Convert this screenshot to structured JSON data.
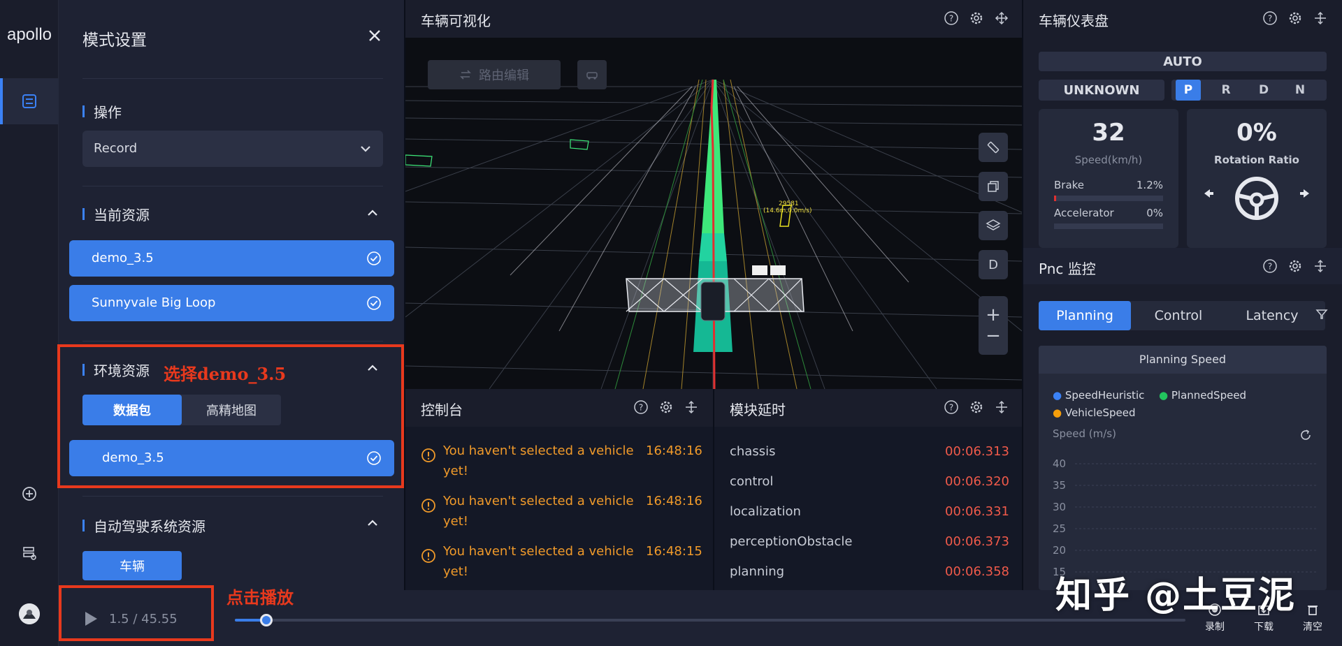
{
  "app": {
    "logo": "apollo"
  },
  "mode_panel": {
    "title": "模式设置",
    "operation": {
      "title": "操作",
      "value": "Record"
    },
    "current_resources": {
      "title": "当前资源",
      "items": [
        "demo_3.5",
        "Sunnyvale Big Loop"
      ]
    },
    "env_resources": {
      "title": "环境资源",
      "tabs": [
        "数据包",
        "高精地图"
      ],
      "active_tab": "数据包",
      "items": [
        "demo_3.5"
      ]
    },
    "ads_resources": {
      "title": "自动驾驶系统资源",
      "button": "车辆"
    }
  },
  "annotations": {
    "select_demo": "选择demo_3.5",
    "click_play": "点击播放"
  },
  "viz": {
    "title": "车辆可视化",
    "route_edit": "路由编辑",
    "tools": [
      "ruler-icon",
      "copy-icon",
      "layers-icon",
      "D",
      "+",
      "−"
    ],
    "labels": {
      "obstacle_id": "29581",
      "obstacle_info": "(14.6m,0.0m/s)"
    }
  },
  "console": {
    "title": "控制台",
    "messages": [
      {
        "text": "You haven't selected a vehicle yet!",
        "time": "16:48:16"
      },
      {
        "text": "You haven't selected a vehicle yet!",
        "time": "16:48:16"
      },
      {
        "text": "You haven't selected a vehicle yet!",
        "time": "16:48:15"
      }
    ]
  },
  "latency": {
    "title": "模块延时",
    "rows": [
      {
        "name": "chassis",
        "value": "00:06.313"
      },
      {
        "name": "control",
        "value": "00:06.320"
      },
      {
        "name": "localization",
        "value": "00:06.331"
      },
      {
        "name": "perceptionObstacle",
        "value": "00:06.373"
      },
      {
        "name": "planning",
        "value": "00:06.358"
      }
    ]
  },
  "dashboard": {
    "title": "车辆仪表盘",
    "mode": "AUTO",
    "status": "UNKNOWN",
    "gears": [
      "P",
      "R",
      "D",
      "N"
    ],
    "active_gear": "P",
    "speed": {
      "value": "32",
      "label": "Speed(km/h)"
    },
    "brake": {
      "label": "Brake",
      "value": "1.2%",
      "fraction": 0.012
    },
    "accelerator": {
      "label": "Accelerator",
      "value": "0%",
      "fraction": 0.0
    },
    "rotation": {
      "value": "0%",
      "label": "Rotation Ratio"
    }
  },
  "pnc": {
    "title": "Pnc 监控",
    "tabs": [
      "Planning",
      "Control",
      "Latency"
    ],
    "active_tab": "Planning",
    "chart": {
      "title": "Planning Speed",
      "legend": [
        "SpeedHeuristic",
        "PlannedSpeed",
        "VehicleSpeed"
      ],
      "legend_colors": [
        "#3b82f6",
        "#22c55e",
        "#f59e0b"
      ],
      "ylabel": "Speed (m/s)",
      "yticks": [
        "40",
        "35",
        "30",
        "25",
        "20",
        "15"
      ]
    }
  },
  "player": {
    "progress": "1.5 / 45.55",
    "fraction": 0.033,
    "actions": [
      "录制",
      "下载",
      "清空"
    ]
  },
  "watermark": "知乎 @土豆泥"
}
